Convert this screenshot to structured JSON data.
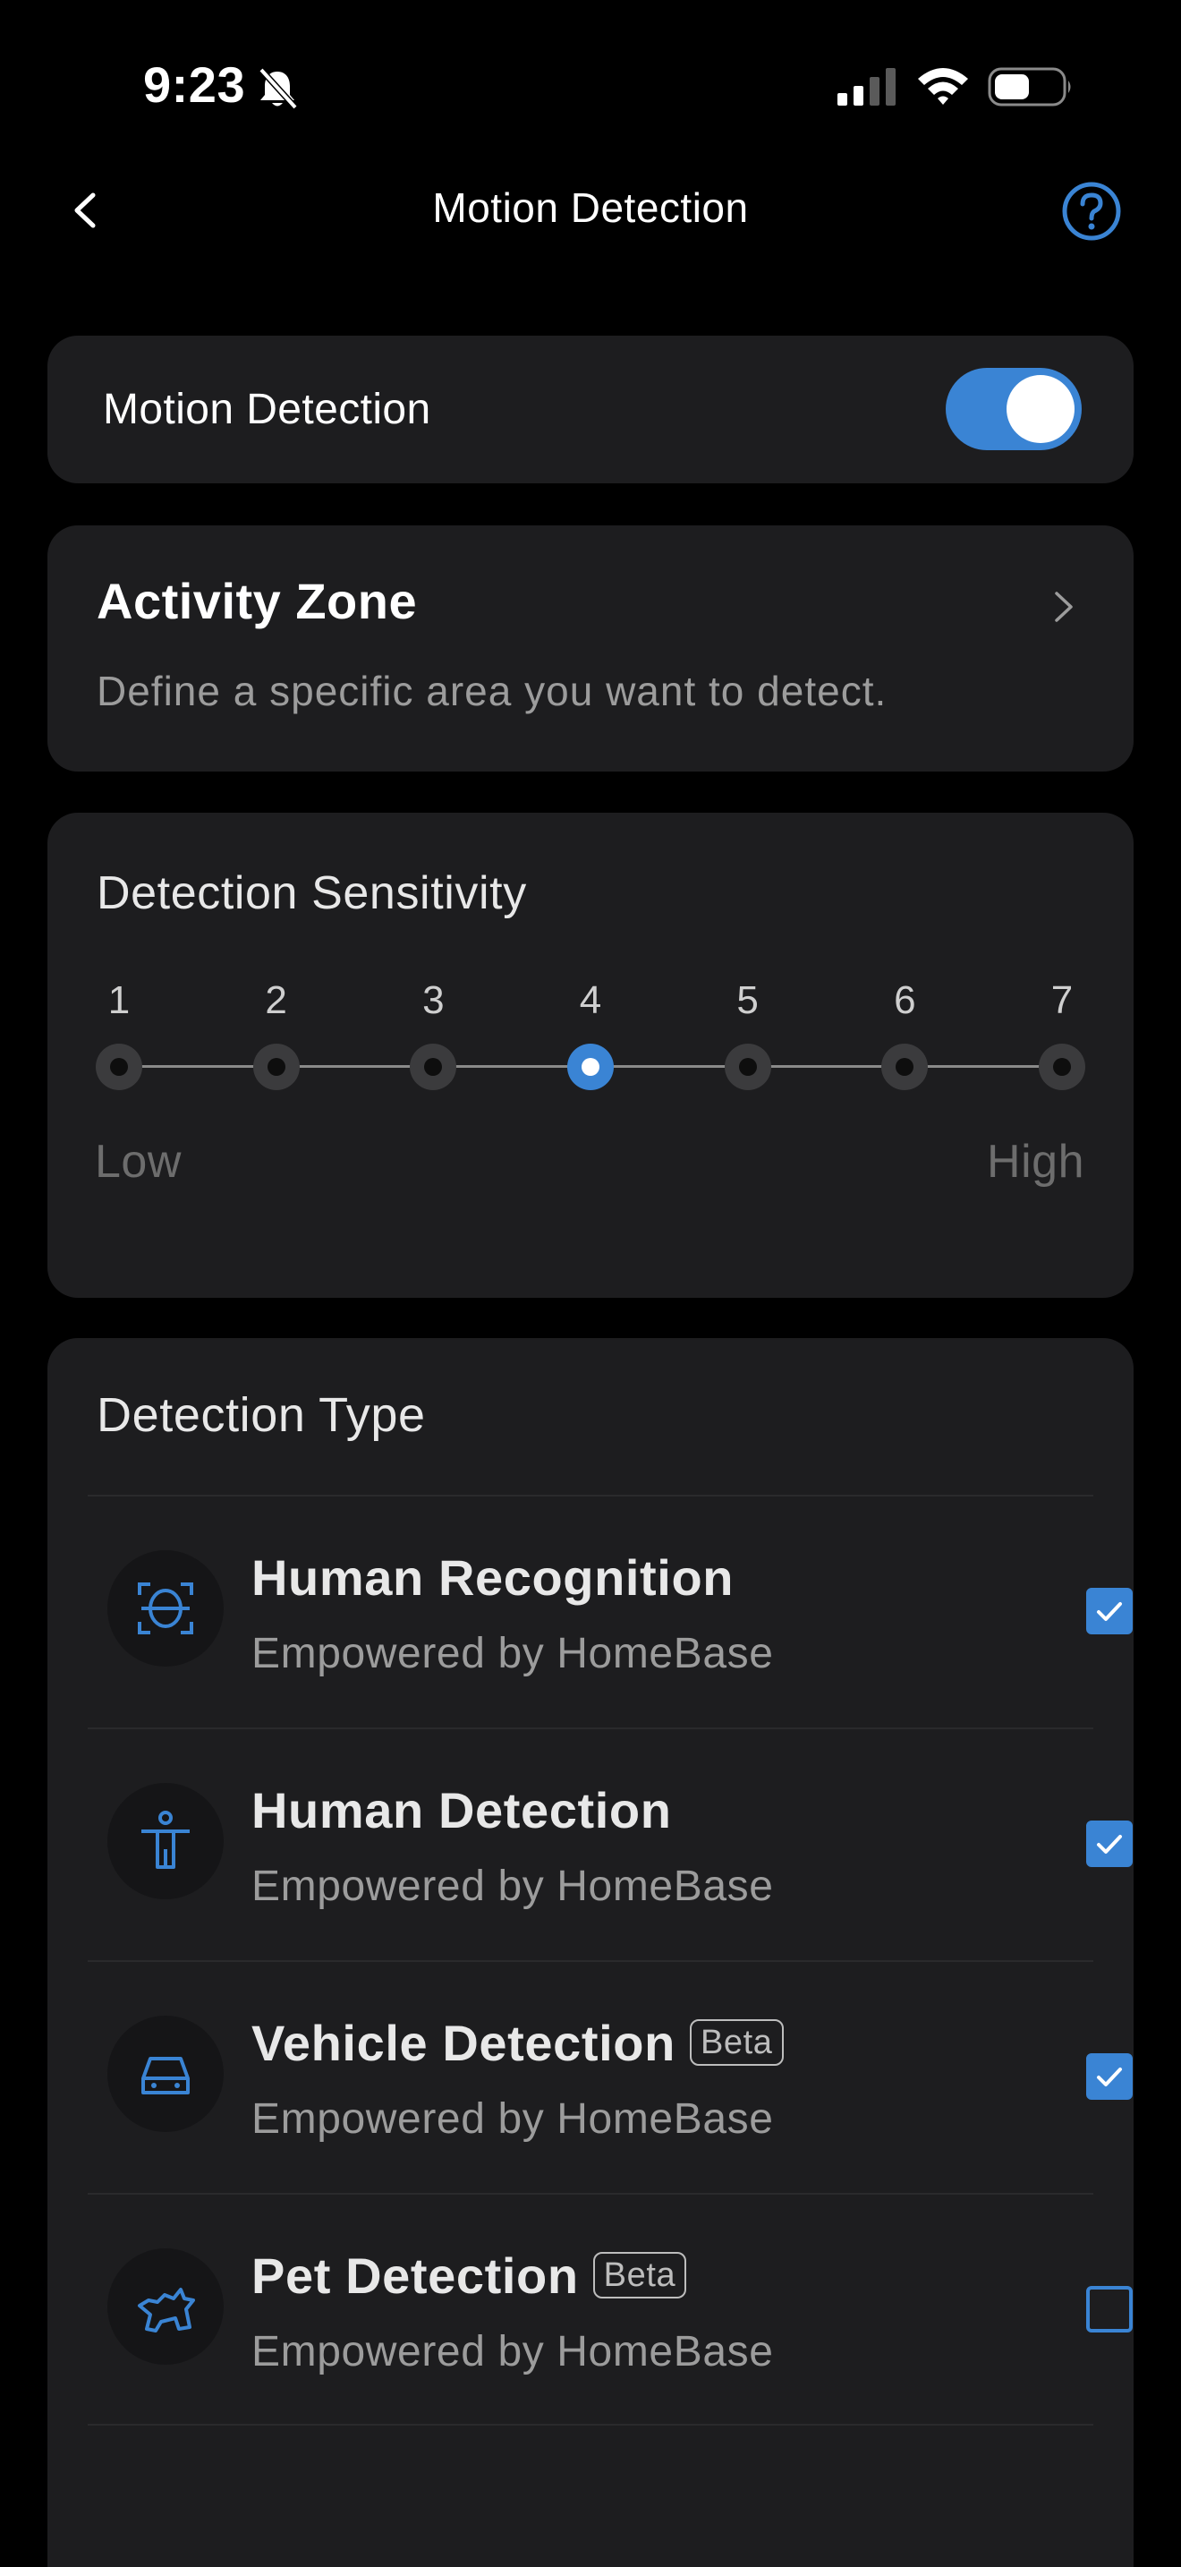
{
  "status_bar": {
    "time": "9:23",
    "icons": [
      "bell-muted-icon",
      "signal-icon",
      "wifi-icon",
      "battery-icon"
    ]
  },
  "nav": {
    "title": "Motion Detection",
    "back_icon": "chevron-left-icon",
    "help_icon": "question-circle-icon"
  },
  "motion": {
    "label": "Motion Detection",
    "enabled": true
  },
  "activity_zone": {
    "title": "Activity Zone",
    "description": "Define a specific area you want to detect."
  },
  "sensitivity": {
    "title": "Detection Sensitivity",
    "levels": [
      "1",
      "2",
      "3",
      "4",
      "5",
      "6",
      "7"
    ],
    "selected": 4,
    "low_label": "Low",
    "high_label": "High"
  },
  "detection_type": {
    "title": "Detection Type",
    "items": [
      {
        "name": "Human Recognition",
        "subtitle": "Empowered by HomeBase",
        "badge": "",
        "icon": "face-scan-icon",
        "checked": true
      },
      {
        "name": "Human Detection",
        "subtitle": "Empowered by HomeBase",
        "badge": "",
        "icon": "person-icon",
        "checked": true
      },
      {
        "name": "Vehicle Detection",
        "subtitle": "Empowered by HomeBase",
        "badge": "Beta",
        "icon": "car-icon",
        "checked": true
      },
      {
        "name": "Pet Detection",
        "subtitle": "Empowered by HomeBase",
        "badge": "Beta",
        "icon": "dog-icon",
        "checked": false
      }
    ]
  },
  "colors": {
    "accent": "#3a84d4",
    "card": "#1d1d1f",
    "background": "#000000"
  }
}
